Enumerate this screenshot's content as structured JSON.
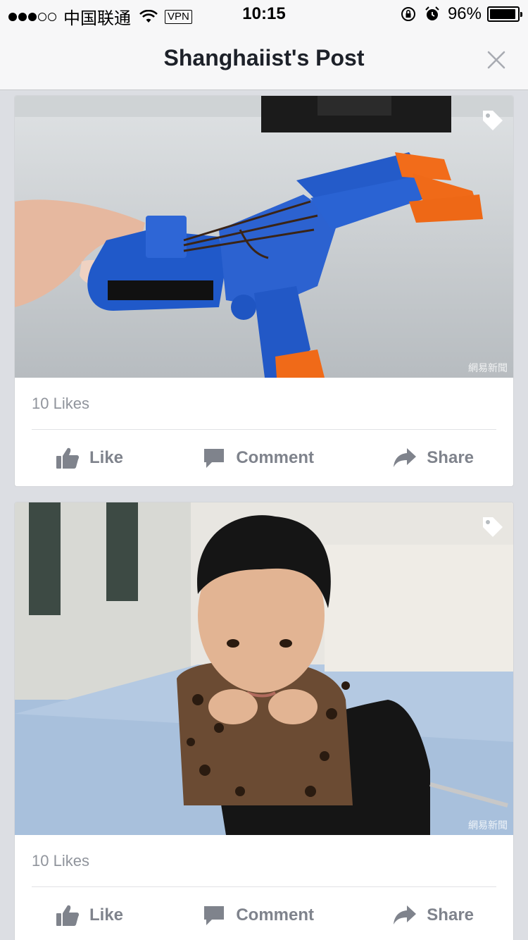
{
  "status_bar": {
    "carrier": "中国联通",
    "vpn": "VPN",
    "time": "10:15",
    "battery_percent": "96%",
    "signal_bars_filled": 3,
    "signal_bars_total": 5
  },
  "header": {
    "title": "Shanghaiist's Post"
  },
  "posts": [
    {
      "likes": "10 Likes",
      "watermark": "網易新聞",
      "actions": {
        "like": "Like",
        "comment": "Comment",
        "share": "Share"
      }
    },
    {
      "likes": "10 Likes",
      "watermark": "網易新聞",
      "actions": {
        "like": "Like",
        "comment": "Comment",
        "share": "Share"
      }
    }
  ],
  "icons": {
    "tag": "tag-icon",
    "like": "thumbs-up-icon",
    "comment": "speech-bubble-icon",
    "share": "share-arrow-icon",
    "close": "close-icon"
  },
  "colors": {
    "action_gray": "#7f838c",
    "likes_gray": "#90949c",
    "nav_background": "#f7f7f8",
    "feed_background": "#dcdee3"
  }
}
